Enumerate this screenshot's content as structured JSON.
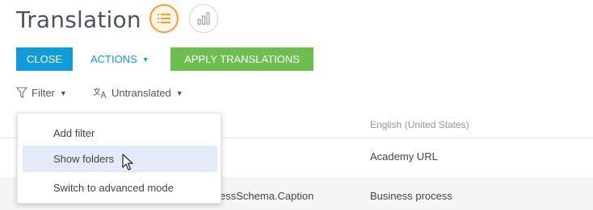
{
  "page": {
    "title": "Translation"
  },
  "view_toggle": {
    "list_icon": "list-icon",
    "analytics_icon": "bar-chart-icon",
    "active_color": "#ff9b2f"
  },
  "toolbar": {
    "close_label": "CLOSE",
    "actions_label": "ACTIONS",
    "apply_label": "APPLY TRANSLATIONS",
    "close_color": "#109bdb",
    "apply_color": "#6cbf4f"
  },
  "filters": {
    "filter_label": "Filter",
    "untranslated_label": "Untranslated"
  },
  "grid": {
    "column_header": "English (United States)",
    "rows": [
      {
        "key": "",
        "value": "Academy URL"
      },
      {
        "key": "essSchema.Caption",
        "value": "Business process"
      }
    ]
  },
  "filter_menu": {
    "items": [
      {
        "label": "Add filter"
      },
      {
        "label": "Show folders"
      },
      {
        "label": "Switch to advanced mode"
      }
    ]
  }
}
